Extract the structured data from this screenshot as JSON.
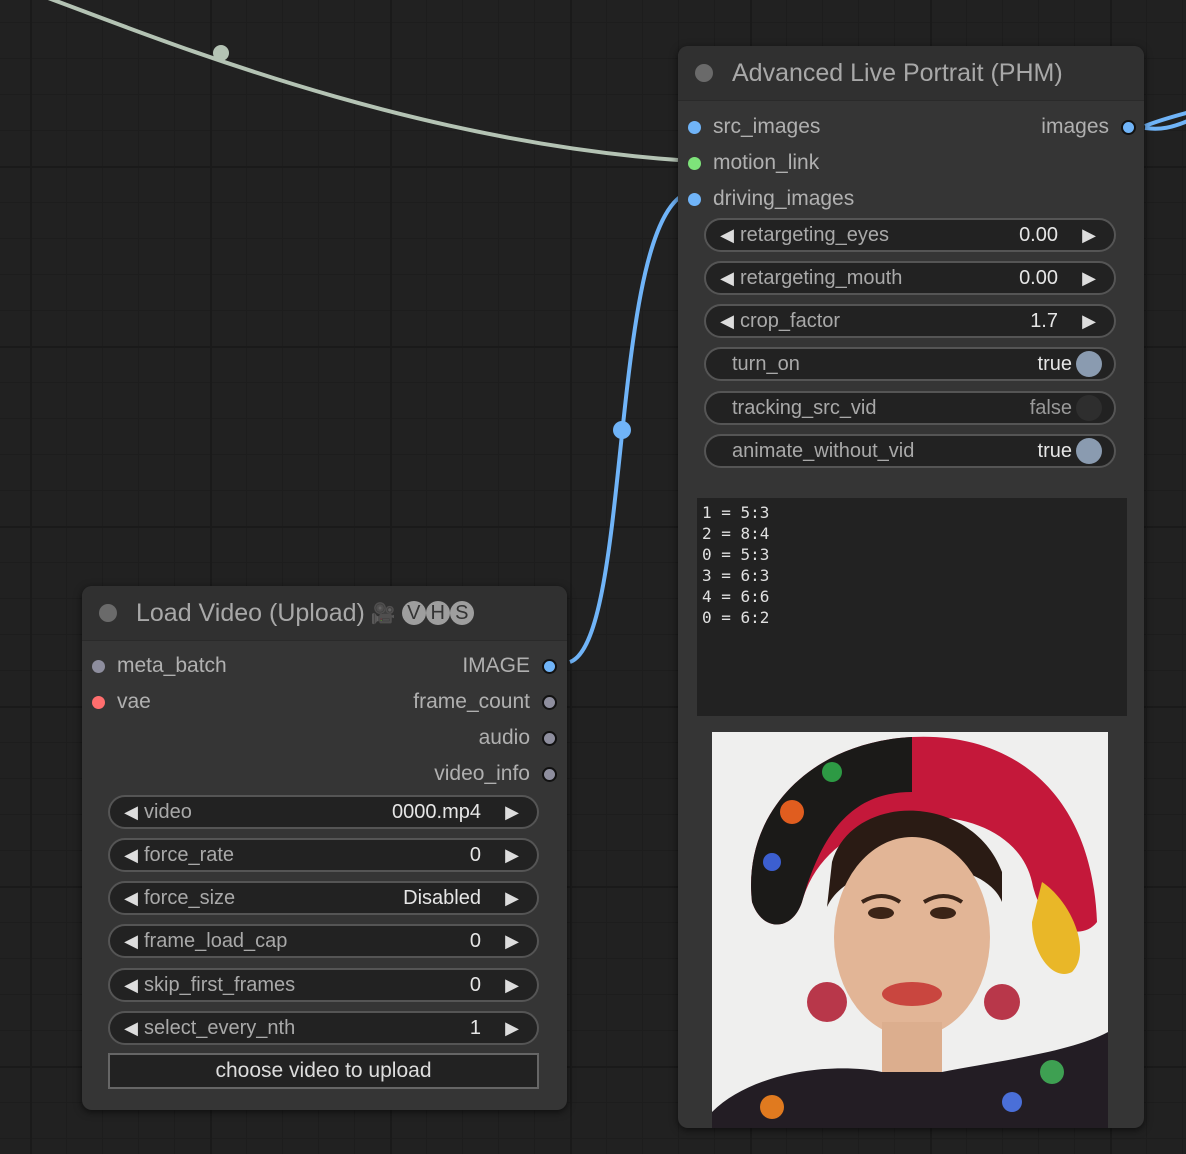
{
  "canvas": {
    "link_colors": {
      "image": "#70b4f8",
      "motion_link": "#b4c3b4"
    }
  },
  "live_portrait_node": {
    "title": "Advanced Live Portrait (PHM)",
    "inputs": [
      {
        "name": "src_images",
        "color": "#70b4f8"
      },
      {
        "name": "motion_link",
        "color": "#7ee37a"
      },
      {
        "name": "driving_images",
        "color": "#70b4f8"
      }
    ],
    "outputs": [
      {
        "name": "images",
        "color": "#70b4f8"
      }
    ],
    "widgets": [
      {
        "type": "number",
        "label": "retargeting_eyes",
        "value": "0.00"
      },
      {
        "type": "number",
        "label": "retargeting_mouth",
        "value": "0.00"
      },
      {
        "type": "number",
        "label": "crop_factor",
        "value": "1.7"
      },
      {
        "type": "toggle",
        "label": "turn_on",
        "value": "true",
        "on": true
      },
      {
        "type": "toggle",
        "label": "tracking_src_vid",
        "value": "false",
        "on": false
      },
      {
        "type": "toggle",
        "label": "animate_without_vid",
        "value": "true",
        "on": true
      }
    ],
    "command_text": "1 = 5:3\n2 = 8:4\n0 = 5:3\n3 = 6:3\n4 = 6:6\n0 = 6:2",
    "preview_image": "portrait of a woman with colorful floral headscarf and earrings"
  },
  "load_video_node": {
    "title": "Load Video (Upload)",
    "title_badge_icon": "film-camera-icon",
    "title_badge_letters": [
      "V",
      "H",
      "S"
    ],
    "inputs": [
      {
        "name": "meta_batch",
        "color": "#8e8e9e"
      },
      {
        "name": "vae",
        "color": "#ff6e6e"
      }
    ],
    "outputs": [
      {
        "name": "IMAGE",
        "color": "#70b4f8"
      },
      {
        "name": "frame_count",
        "color": "#8e8e9e"
      },
      {
        "name": "audio",
        "color": "#8e8e9e"
      },
      {
        "name": "video_info",
        "color": "#8e8e9e"
      }
    ],
    "widgets": [
      {
        "label": "video",
        "value": "0000.mp4"
      },
      {
        "label": "force_rate",
        "value": "0"
      },
      {
        "label": "force_size",
        "value": "Disabled"
      },
      {
        "label": "frame_load_cap",
        "value": "0"
      },
      {
        "label": "skip_first_frames",
        "value": "0"
      },
      {
        "label": "select_every_nth",
        "value": "1"
      }
    ],
    "upload_button_label": "choose video to upload"
  }
}
